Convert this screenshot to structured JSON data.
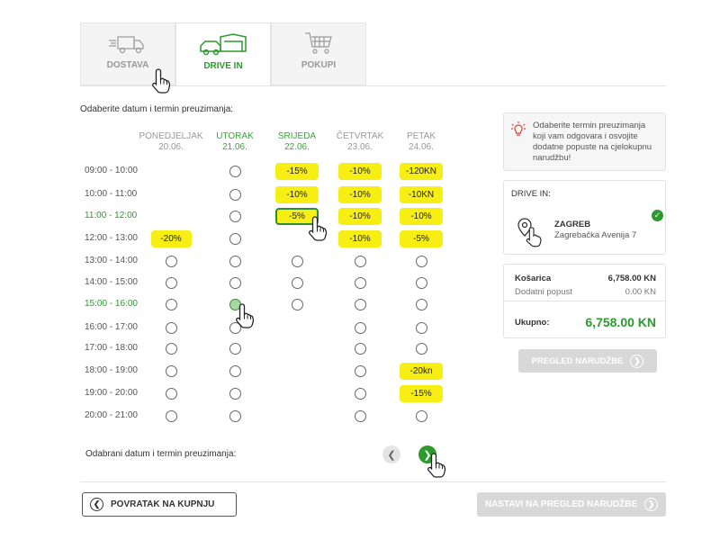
{
  "tabs": [
    {
      "label": "DOSTAVA",
      "icon": "truck-icon"
    },
    {
      "label": "DRIVE IN",
      "icon": "drive-in-icon"
    },
    {
      "label": "POKUPI",
      "icon": "cart-icon"
    }
  ],
  "active_tab": "DRIVE IN",
  "instruction": "Odaberite datum i termin preuzimanja:",
  "days": [
    {
      "name": "PONEDJELJAK",
      "date": "20.06."
    },
    {
      "name": "UTORAK",
      "date": "21.06."
    },
    {
      "name": "SRIJEDA",
      "date": "22.06."
    },
    {
      "name": "ČETVRTAK",
      "date": "23.06."
    },
    {
      "name": "PETAK",
      "date": "24.06."
    }
  ],
  "active_days": [
    1,
    2
  ],
  "times": [
    "09:00 - 10:00",
    "10:00 - 11:00",
    "11:00 - 12:00",
    "12:00 - 13:00",
    "13:00 - 14:00",
    "14:00 - 15:00",
    "15:00 - 16:00",
    "16:00 - 17:00",
    "17:00 - 18:00",
    "18:00 - 19:00",
    "19:00 - 20:00",
    "20:00 - 21:00"
  ],
  "active_times": [
    2,
    6
  ],
  "slots": [
    [
      "",
      "o",
      "-15%",
      "-10%",
      "-120KN"
    ],
    [
      "",
      "o",
      "-10%",
      "-10%",
      "-10KN"
    ],
    [
      "",
      "o",
      "-5%",
      "-10%",
      "-10%"
    ],
    [
      "-20%",
      "o",
      "",
      "-10%",
      "-5%"
    ],
    [
      "o",
      "o",
      "o",
      "o",
      "o"
    ],
    [
      "o",
      "o",
      "o",
      "o",
      "o"
    ],
    [
      "o",
      "o",
      "o",
      "o",
      "o"
    ],
    [
      "o",
      "o",
      "",
      "o",
      "o"
    ],
    [
      "o",
      "o",
      "",
      "o",
      "o"
    ],
    [
      "o",
      "o",
      "",
      "o",
      "-20kn"
    ],
    [
      "o",
      "o",
      "",
      "o",
      "-15%"
    ],
    [
      "o",
      "o",
      "",
      "o",
      "o"
    ]
  ],
  "selected_slots": [
    [
      2,
      2
    ],
    [
      6,
      1
    ]
  ],
  "chosen_label": "Odabrani datum i termin preuzimanja:",
  "info_text": "Odaberite termin preuzimanja koji vam odgovara i osvojite dodatne popuste na cjelokupnu narudžbu!",
  "drive_in": {
    "heading": "DRIVE IN:",
    "city": "ZAGREB",
    "address": "Zagrebačka Avenija 7"
  },
  "cart": {
    "label": "Košarica",
    "amount": "6,758.00 KN",
    "discount_label": "Dodatni popust",
    "discount": "0.00 KN",
    "total_label": "Ukupno:",
    "total": "6,758.00 KN"
  },
  "review_button": "PREGLED NARUDŽBE",
  "back_button": "POVRATAK NA KUPNJU",
  "continue_button": "NASTAVI NA PREGLED NARUDŽBE",
  "colors": {
    "accent": "#2c9a2c",
    "promo": "#f7ee14",
    "disabled": "#d8d8d8"
  }
}
